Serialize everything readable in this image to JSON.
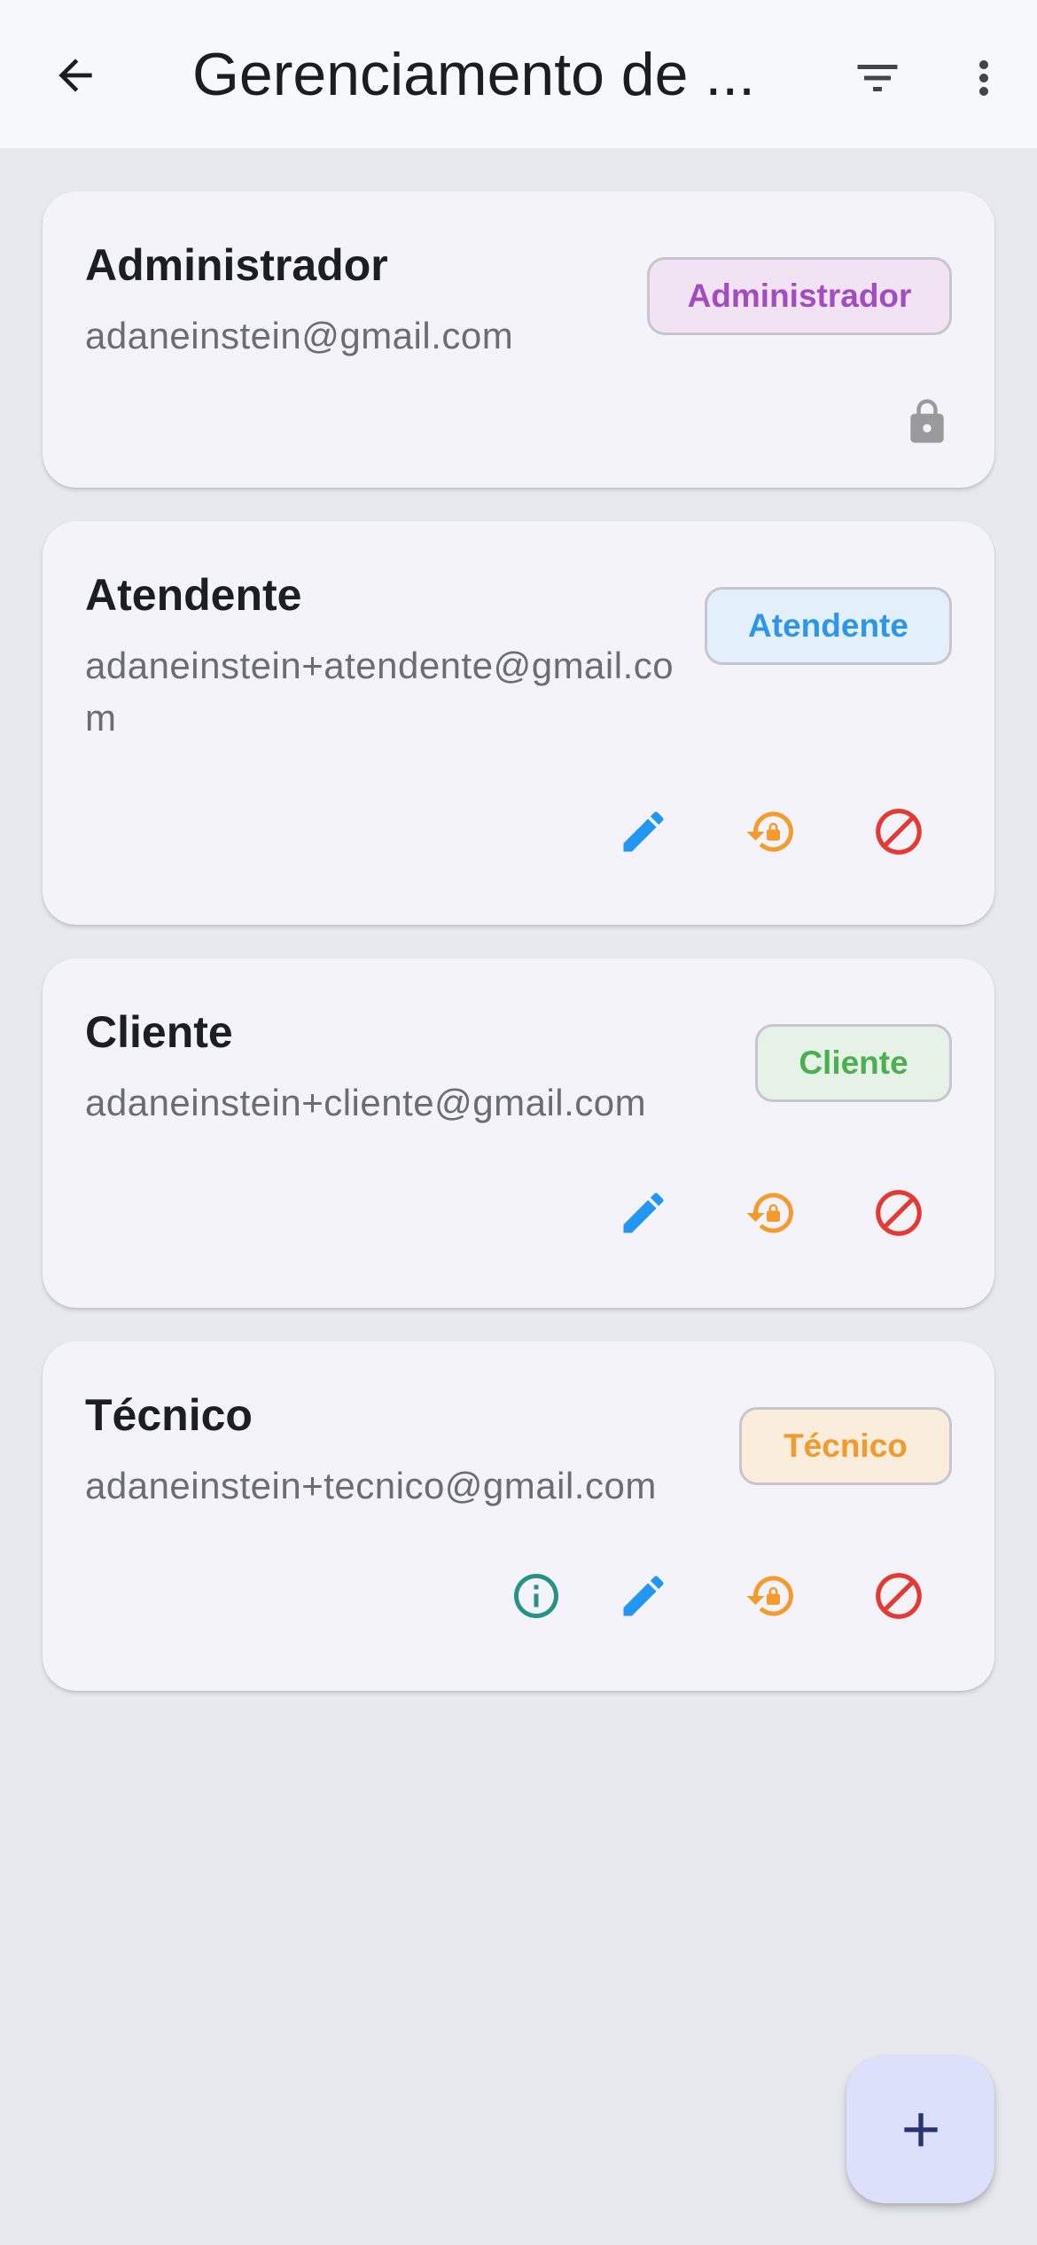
{
  "appbar": {
    "title": "Gerenciamento de ..."
  },
  "icons": {
    "back": "arrow-left",
    "filter": "filter-list",
    "more": "more-vertical",
    "lock": "lock",
    "edit": "pencil",
    "reset_password": "lock-reset",
    "block": "block",
    "info": "info",
    "add": "plus"
  },
  "colors": {
    "admin": "#a24cc0",
    "atendente": "#2e96ea",
    "cliente": "#4caf50",
    "tecnico": "#f39a2f",
    "edit": "#2196f3",
    "reset": "#f59a2c",
    "block": "#e53935",
    "info": "#2a9187",
    "lock": "#9a9a9a"
  },
  "users": [
    {
      "name": "Administrador",
      "email": "adaneinstein@gmail.com",
      "role": "Administrador"
    },
    {
      "name": "Atendente",
      "email": "adaneinstein+atendente@gmail.com",
      "role": "Atendente"
    },
    {
      "name": "Cliente",
      "email": "adaneinstein+cliente@gmail.com",
      "role": "Cliente"
    },
    {
      "name": "Técnico",
      "email": "adaneinstein+tecnico@gmail.com",
      "role": "Técnico"
    }
  ]
}
